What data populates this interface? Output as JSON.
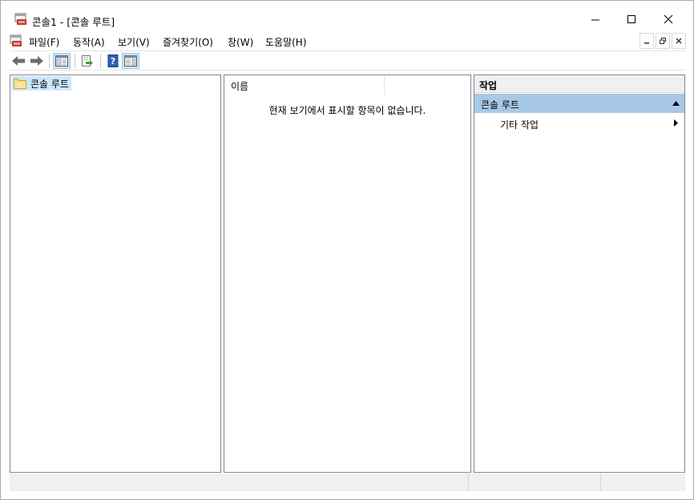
{
  "window": {
    "title": "콘솔1 - [콘솔 루트]"
  },
  "menu": {
    "items": [
      "파일(F)",
      "동작(A)",
      "보기(V)",
      "즐겨찾기(O)",
      "창(W)",
      "도움말(H)"
    ]
  },
  "toolbar": {
    "buttons": [
      "back-arrow-icon",
      "forward-arrow-icon",
      "show-hide-tree-icon",
      "export-list-icon",
      "help-icon",
      "show-hide-action-pane-icon"
    ]
  },
  "tree": {
    "root_label": "콘솔 루트"
  },
  "list": {
    "column_name": "이름",
    "empty_message": "현재 보기에서 표시할 항목이 없습니다."
  },
  "actions": {
    "header": "작업",
    "group_label": "콘솔 루트",
    "item_label": "기타 작업"
  },
  "colors": {
    "selection": "#cce8ff",
    "action_group": "#a8c9e6",
    "toolbar_pressed": "#cce4f7"
  }
}
